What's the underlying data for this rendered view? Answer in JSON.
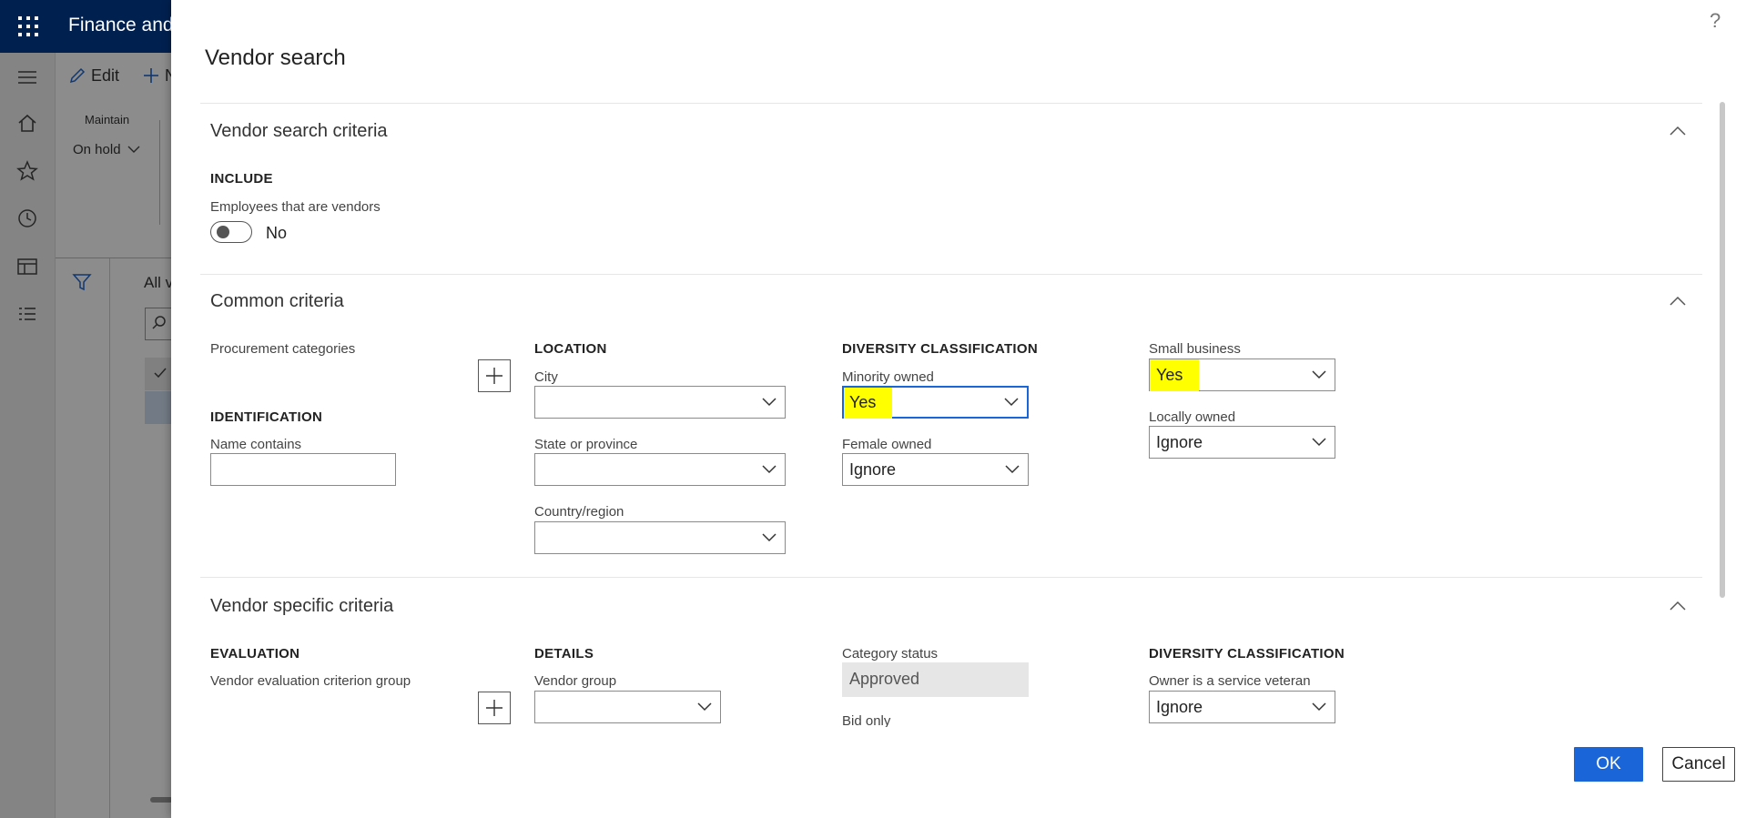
{
  "app": {
    "title": "Finance and"
  },
  "background": {
    "edit_label": "Edit",
    "new_label": "N",
    "maintain_label": "Maintain",
    "on_hold_label": "On hold",
    "all_label": "All v"
  },
  "dialog": {
    "title": "Vendor search",
    "help_label": "?",
    "ok_label": "OK",
    "cancel_label": "Cancel"
  },
  "vendor_search_criteria": {
    "heading": "Vendor search criteria",
    "include_header": "INCLUDE",
    "employees_label": "Employees that are vendors",
    "employees_value": "No"
  },
  "common_criteria": {
    "heading": "Common criteria",
    "procurement_label": "Procurement categories",
    "identification_header": "IDENTIFICATION",
    "name_contains_label": "Name contains",
    "name_contains_value": "",
    "location_header": "LOCATION",
    "city_label": "City",
    "city_value": "",
    "state_label": "State or province",
    "state_value": "",
    "country_label": "Country/region",
    "country_value": "",
    "diversity_header": "DIVERSITY CLASSIFICATION",
    "minority_label": "Minority owned",
    "minority_value": "Yes",
    "female_label": "Female owned",
    "female_value": "Ignore",
    "small_business_label": "Small business",
    "small_business_value": "Yes",
    "locally_owned_label": "Locally owned",
    "locally_owned_value": "Ignore"
  },
  "vendor_specific_criteria": {
    "heading": "Vendor specific criteria",
    "evaluation_header": "EVALUATION",
    "eval_group_label": "Vendor evaluation criterion group",
    "details_header": "DETAILS",
    "vendor_group_label": "Vendor group",
    "vendor_group_value": "",
    "category_status_label": "Category status",
    "category_status_value": "Approved",
    "bid_only_label": "Bid only",
    "diversity_header": "DIVERSITY CLASSIFICATION",
    "veteran_label": "Owner is a service veteran",
    "veteran_value": "Ignore"
  },
  "colors": {
    "accent": "#1a66d9",
    "highlight": "#ffff00",
    "topbar": "#002050"
  }
}
